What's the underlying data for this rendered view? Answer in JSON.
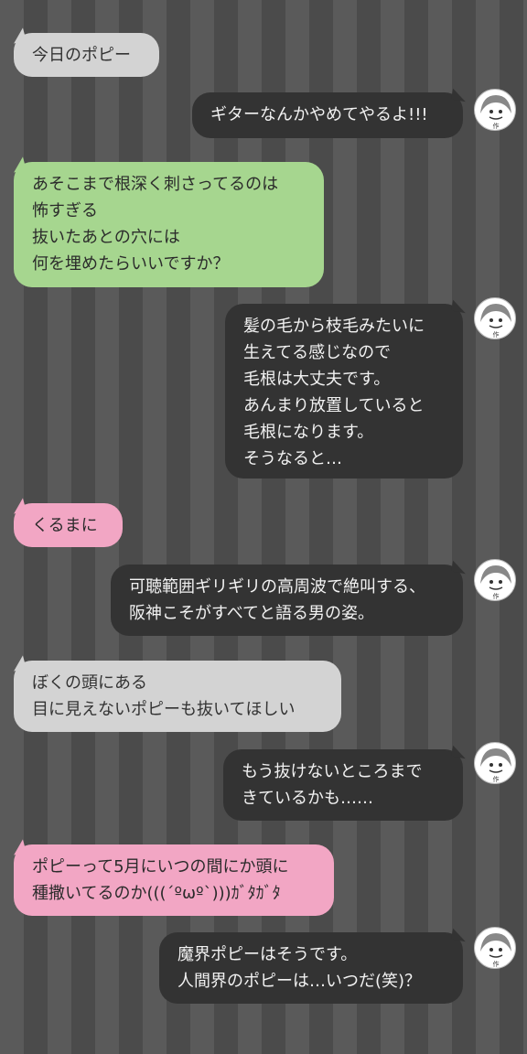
{
  "messages": [
    {
      "side": "left",
      "color": "gray",
      "text": "今日のポピー"
    },
    {
      "side": "right",
      "color": "dark",
      "text": "ギターなんかやめてやるよ!!!"
    },
    {
      "side": "left",
      "color": "green",
      "text": "あそこまで根深く刺さってるのは\n怖すぎる\n抜いたあとの穴には\n何を埋めたらいいですか？"
    },
    {
      "side": "right",
      "color": "dark",
      "text": "髪の毛から枝毛みたいに\n生えてる感じなので\n毛根は大丈夫です。\nあんまり放置していると\n毛根になります。\nそうなると…"
    },
    {
      "side": "left",
      "color": "pink",
      "text": "くるまに"
    },
    {
      "side": "right",
      "color": "dark",
      "text": "可聴範囲ギリギリの高周波で絶叫する、\n阪神こそがすべてと語る男の姿。"
    },
    {
      "side": "left",
      "color": "gray",
      "text": "ぼくの頭にある\n目に見えないポピーも抜いてほしい"
    },
    {
      "side": "right",
      "color": "dark",
      "text": "もう抜けないところまで\nきているかも……"
    },
    {
      "side": "left",
      "color": "pink",
      "text": "ポピーって5月にいつの間にか頭に\n種撒いてるのか(((´ºωº`)))ｶﾞﾀｶﾞﾀ"
    },
    {
      "side": "right",
      "color": "dark",
      "text": "魔界ポピーはそうです。\n人間界のポピーは…いつだ(笑)？"
    }
  ],
  "avatar": {
    "icon": "author-avatar-icon",
    "caption": "作"
  }
}
